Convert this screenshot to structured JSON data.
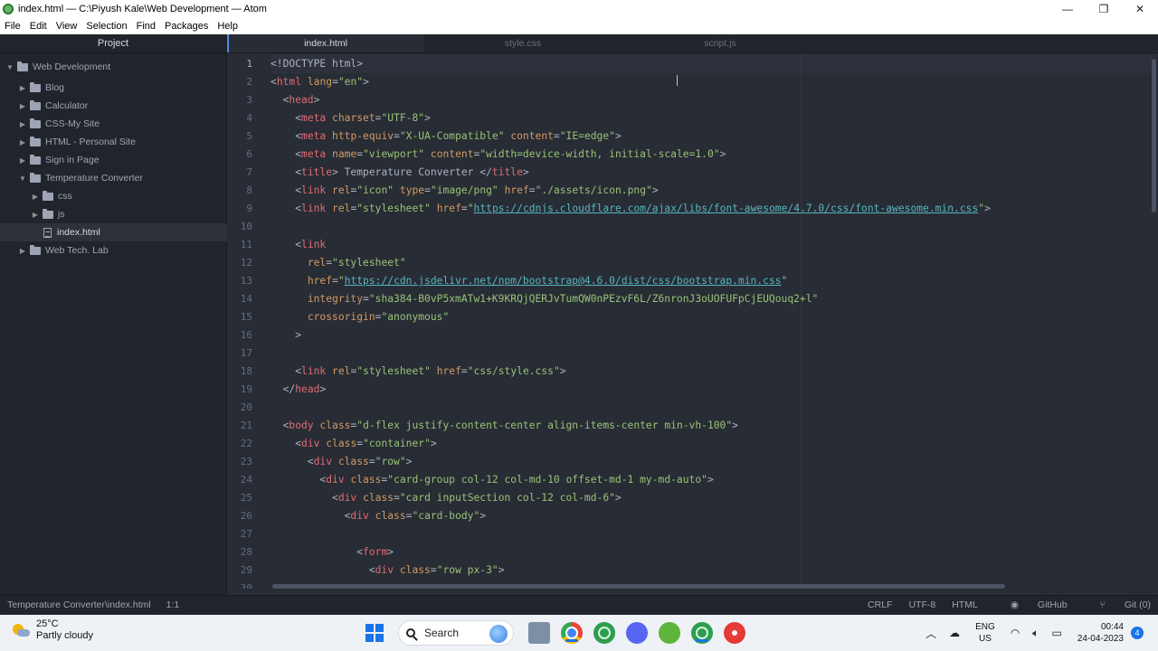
{
  "window": {
    "title": "index.html — C:\\Piyush Kale\\Web Development — Atom",
    "minimize": "—",
    "maximize": "❐",
    "close": "✕"
  },
  "menu": [
    "File",
    "Edit",
    "View",
    "Selection",
    "Find",
    "Packages",
    "Help"
  ],
  "sidebar": {
    "header": "Project",
    "items": [
      {
        "label": "Web Development",
        "type": "folder",
        "open": true
      },
      {
        "label": "Blog",
        "type": "folder",
        "open": false
      },
      {
        "label": "Calculator",
        "type": "folder",
        "open": false
      },
      {
        "label": "CSS-My Site",
        "type": "folder",
        "open": false
      },
      {
        "label": "HTML - Personal Site",
        "type": "folder",
        "open": false
      },
      {
        "label": "Sign in Page",
        "type": "folder",
        "open": false
      },
      {
        "label": "Temperature Converter",
        "type": "folder",
        "open": true
      },
      {
        "label": "css",
        "type": "folder",
        "open": false
      },
      {
        "label": "js",
        "type": "folder",
        "open": false
      },
      {
        "label": "index.html",
        "type": "file",
        "selected": true
      },
      {
        "label": "Web Tech. Lab",
        "type": "folder",
        "open": false
      }
    ]
  },
  "tabs": [
    {
      "label": "index.html",
      "active": true
    },
    {
      "label": "style.css",
      "active": false
    },
    {
      "label": "script.js",
      "active": false
    }
  ],
  "editor": {
    "line_numbers": [
      "1",
      "2",
      "3",
      "4",
      "5",
      "6",
      "7",
      "8",
      "9",
      "10",
      "11",
      "12",
      "13",
      "14",
      "15",
      "16",
      "17",
      "18",
      "19",
      "20",
      "21",
      "22",
      "23",
      "24",
      "25",
      "26",
      "27",
      "28",
      "29",
      "30"
    ],
    "lines": [
      [
        [
          "p",
          "<!DOCTYPE html>"
        ]
      ],
      [
        [
          "p",
          "<"
        ],
        [
          "t",
          "html"
        ],
        [
          "p",
          " "
        ],
        [
          "a",
          "lang"
        ],
        [
          "p",
          "="
        ],
        [
          "s",
          "\"en\""
        ],
        [
          "p",
          ">"
        ]
      ],
      [
        [
          "p",
          "  <"
        ],
        [
          "t",
          "head"
        ],
        [
          "p",
          ">"
        ]
      ],
      [
        [
          "p",
          "    <"
        ],
        [
          "t",
          "meta"
        ],
        [
          "p",
          " "
        ],
        [
          "a",
          "charset"
        ],
        [
          "p",
          "="
        ],
        [
          "s",
          "\"UTF-8\""
        ],
        [
          "p",
          ">"
        ]
      ],
      [
        [
          "p",
          "    <"
        ],
        [
          "t",
          "meta"
        ],
        [
          "p",
          " "
        ],
        [
          "a",
          "http-equiv"
        ],
        [
          "p",
          "="
        ],
        [
          "s",
          "\"X-UA-Compatible\""
        ],
        [
          "p",
          " "
        ],
        [
          "a",
          "content"
        ],
        [
          "p",
          "="
        ],
        [
          "s",
          "\"IE=edge\""
        ],
        [
          "p",
          ">"
        ]
      ],
      [
        [
          "p",
          "    <"
        ],
        [
          "t",
          "meta"
        ],
        [
          "p",
          " "
        ],
        [
          "a",
          "name"
        ],
        [
          "p",
          "="
        ],
        [
          "s",
          "\"viewport\""
        ],
        [
          "p",
          " "
        ],
        [
          "a",
          "content"
        ],
        [
          "p",
          "="
        ],
        [
          "s",
          "\"width=device-width, initial-scale=1.0\""
        ],
        [
          "p",
          ">"
        ]
      ],
      [
        [
          "p",
          "    <"
        ],
        [
          "t",
          "title"
        ],
        [
          "p",
          "> Temperature Converter </"
        ],
        [
          "t",
          "title"
        ],
        [
          "p",
          ">"
        ]
      ],
      [
        [
          "p",
          "    <"
        ],
        [
          "t",
          "link"
        ],
        [
          "p",
          " "
        ],
        [
          "a",
          "rel"
        ],
        [
          "p",
          "="
        ],
        [
          "s",
          "\"icon\""
        ],
        [
          "p",
          " "
        ],
        [
          "a",
          "type"
        ],
        [
          "p",
          "="
        ],
        [
          "s",
          "\"image/png\""
        ],
        [
          "p",
          " "
        ],
        [
          "a",
          "href"
        ],
        [
          "p",
          "="
        ],
        [
          "s",
          "\"./assets/icon.png\""
        ],
        [
          "p",
          ">"
        ]
      ],
      [
        [
          "p",
          "    <"
        ],
        [
          "t",
          "link"
        ],
        [
          "p",
          " "
        ],
        [
          "a",
          "rel"
        ],
        [
          "p",
          "="
        ],
        [
          "s",
          "\"stylesheet\""
        ],
        [
          "p",
          " "
        ],
        [
          "a",
          "href"
        ],
        [
          "p",
          "="
        ],
        [
          "s",
          "\""
        ],
        [
          "u",
          "https://cdnjs.cloudflare.com/ajax/libs/font-awesome/4.7.0/css/font-awesome.min.css"
        ],
        [
          "s",
          "\""
        ],
        [
          "p",
          ">"
        ]
      ],
      [
        [
          "p",
          ""
        ]
      ],
      [
        [
          "p",
          "    <"
        ],
        [
          "t",
          "link"
        ]
      ],
      [
        [
          "p",
          "      "
        ],
        [
          "a",
          "rel"
        ],
        [
          "p",
          "="
        ],
        [
          "s",
          "\"stylesheet\""
        ]
      ],
      [
        [
          "p",
          "      "
        ],
        [
          "a",
          "href"
        ],
        [
          "p",
          "="
        ],
        [
          "s",
          "\""
        ],
        [
          "u",
          "https://cdn.jsdelivr.net/npm/bootstrap@4.6.0/dist/css/bootstrap.min.css"
        ],
        [
          "s",
          "\""
        ]
      ],
      [
        [
          "p",
          "      "
        ],
        [
          "a",
          "integrity"
        ],
        [
          "p",
          "="
        ],
        [
          "s",
          "\"sha384-B0vP5xmATw1+K9KRQjQERJvTumQW0nPEzvF6L/Z6nronJ3oUOFUFpCjEUQouq2+l\""
        ]
      ],
      [
        [
          "p",
          "      "
        ],
        [
          "a",
          "crossorigin"
        ],
        [
          "p",
          "="
        ],
        [
          "s",
          "\"anonymous\""
        ]
      ],
      [
        [
          "p",
          "    >"
        ]
      ],
      [
        [
          "p",
          ""
        ]
      ],
      [
        [
          "p",
          "    <"
        ],
        [
          "t",
          "link"
        ],
        [
          "p",
          " "
        ],
        [
          "a",
          "rel"
        ],
        [
          "p",
          "="
        ],
        [
          "s",
          "\"stylesheet\""
        ],
        [
          "p",
          " "
        ],
        [
          "a",
          "href"
        ],
        [
          "p",
          "="
        ],
        [
          "s",
          "\"css/style.css\""
        ],
        [
          "p",
          ">"
        ]
      ],
      [
        [
          "p",
          "  </"
        ],
        [
          "t",
          "head"
        ],
        [
          "p",
          ">"
        ]
      ],
      [
        [
          "p",
          ""
        ]
      ],
      [
        [
          "p",
          "  <"
        ],
        [
          "t",
          "body"
        ],
        [
          "p",
          " "
        ],
        [
          "a",
          "class"
        ],
        [
          "p",
          "="
        ],
        [
          "s",
          "\"d-flex justify-content-center align-items-center min-vh-100\""
        ],
        [
          "p",
          ">"
        ]
      ],
      [
        [
          "p",
          "    <"
        ],
        [
          "t",
          "div"
        ],
        [
          "p",
          " "
        ],
        [
          "a",
          "class"
        ],
        [
          "p",
          "="
        ],
        [
          "s",
          "\"container\""
        ],
        [
          "p",
          ">"
        ]
      ],
      [
        [
          "p",
          "      <"
        ],
        [
          "t",
          "div"
        ],
        [
          "p",
          " "
        ],
        [
          "a",
          "class"
        ],
        [
          "p",
          "="
        ],
        [
          "s",
          "\"row\""
        ],
        [
          "p",
          ">"
        ]
      ],
      [
        [
          "p",
          "        <"
        ],
        [
          "t",
          "div"
        ],
        [
          "p",
          " "
        ],
        [
          "a",
          "class"
        ],
        [
          "p",
          "="
        ],
        [
          "s",
          "\"card-group col-12 col-md-10 offset-md-1 my-md-auto\""
        ],
        [
          "p",
          ">"
        ]
      ],
      [
        [
          "p",
          "          <"
        ],
        [
          "t",
          "div"
        ],
        [
          "p",
          " "
        ],
        [
          "a",
          "class"
        ],
        [
          "p",
          "="
        ],
        [
          "s",
          "\"card inputSection col-12 col-md-6\""
        ],
        [
          "p",
          ">"
        ]
      ],
      [
        [
          "p",
          "            <"
        ],
        [
          "t",
          "div"
        ],
        [
          "p",
          " "
        ],
        [
          "a",
          "class"
        ],
        [
          "p",
          "="
        ],
        [
          "s",
          "\"card-body\""
        ],
        [
          "p",
          ">"
        ]
      ],
      [
        [
          "p",
          ""
        ]
      ],
      [
        [
          "p",
          "              <"
        ],
        [
          "t",
          "form"
        ],
        [
          "p",
          ">"
        ]
      ],
      [
        [
          "p",
          "                <"
        ],
        [
          "t",
          "div"
        ],
        [
          "p",
          " "
        ],
        [
          "a",
          "class"
        ],
        [
          "p",
          "="
        ],
        [
          "s",
          "\"row px-3\""
        ],
        [
          "p",
          ">"
        ]
      ]
    ]
  },
  "status": {
    "path": "Temperature Converter\\index.html",
    "cursor": "1:1",
    "line_ending": "CRLF",
    "encoding": "UTF-8",
    "grammar": "HTML",
    "github": "GitHub",
    "git": "Git (0)"
  },
  "taskbar": {
    "temperature": "25°C",
    "weather": "Partly cloudy",
    "search_label": "Search",
    "lang_top": "ENG",
    "lang_bottom": "US",
    "time": "00:44",
    "date": "24-04-2023",
    "notifications": "4"
  }
}
